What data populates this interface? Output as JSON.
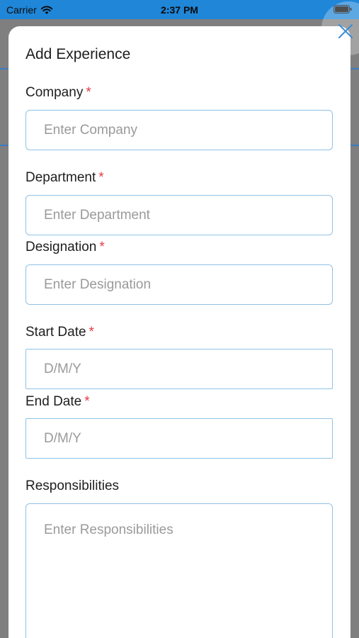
{
  "status_bar": {
    "carrier": "Carrier",
    "time": "2:37 PM",
    "wifi_icon": "wifi-icon",
    "battery_icon": "battery-icon"
  },
  "colors": {
    "status_bar_bg": "#1f86d8",
    "input_border": "#8fc2e6",
    "required_star": "#e53946",
    "overlay": "#7f7f7f"
  },
  "modal": {
    "title": "Add Experience",
    "close_icon": "close-icon",
    "required_mark": "*",
    "fields": {
      "company": {
        "label": "Company",
        "placeholder": "Enter Company",
        "value": ""
      },
      "department": {
        "label": "Department",
        "placeholder": "Enter Department",
        "value": ""
      },
      "designation": {
        "label": "Designation",
        "placeholder": "Enter Designation",
        "value": ""
      },
      "start_date": {
        "label": "Start Date",
        "placeholder": "D/M/Y",
        "value": ""
      },
      "end_date": {
        "label": "End Date",
        "placeholder": "D/M/Y",
        "value": ""
      },
      "responsibilities": {
        "label": "Responsibilities",
        "placeholder": "Enter Responsibilities",
        "value": ""
      }
    }
  }
}
